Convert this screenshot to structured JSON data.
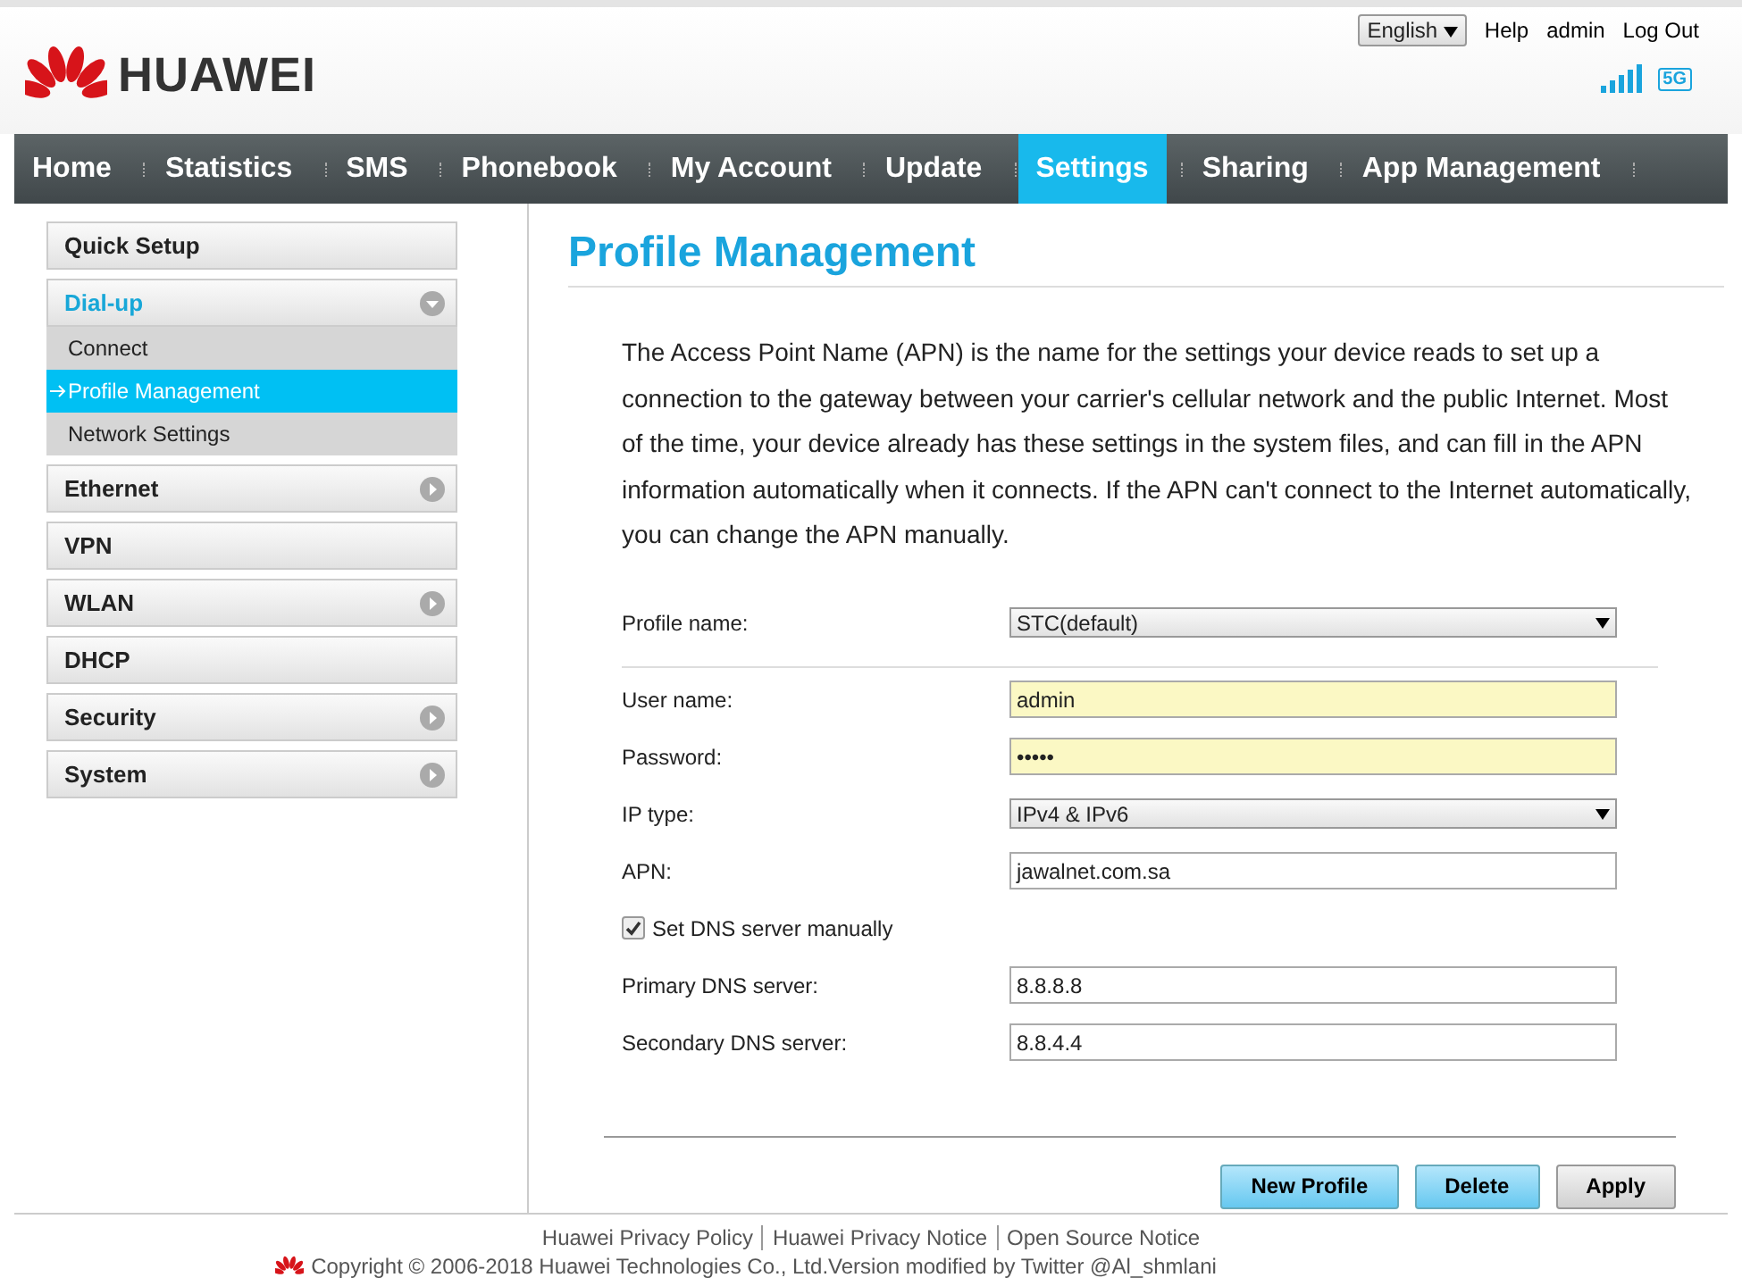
{
  "top_links": {
    "language": "English",
    "links": [
      "Help",
      "admin",
      "Log Out"
    ]
  },
  "brand": {
    "name": "HUAWEI"
  },
  "status": {
    "network_badge": "5G"
  },
  "nav": [
    {
      "label": "Home",
      "selected": false
    },
    {
      "label": "Statistics",
      "selected": false
    },
    {
      "label": "SMS",
      "selected": false
    },
    {
      "label": "Phonebook",
      "selected": false
    },
    {
      "label": "My Account",
      "selected": false
    },
    {
      "label": "Update",
      "selected": false
    },
    {
      "label": "Settings",
      "selected": true
    },
    {
      "label": "Sharing",
      "selected": false
    },
    {
      "label": "App Management",
      "selected": false
    }
  ],
  "sidebar": {
    "items": [
      {
        "label": "Quick Setup",
        "kind": "link"
      },
      {
        "label": "Dial-up",
        "kind": "group",
        "expanded": true,
        "children": [
          {
            "label": "Connect",
            "selected": false
          },
          {
            "label": "Profile Management",
            "selected": true
          },
          {
            "label": "Network Settings",
            "selected": false
          }
        ]
      },
      {
        "label": "Ethernet",
        "kind": "group",
        "expanded": false
      },
      {
        "label": "VPN",
        "kind": "link"
      },
      {
        "label": "WLAN",
        "kind": "group",
        "expanded": false
      },
      {
        "label": "DHCP",
        "kind": "link"
      },
      {
        "label": "Security",
        "kind": "group",
        "expanded": false
      },
      {
        "label": "System",
        "kind": "group",
        "expanded": false
      }
    ]
  },
  "page": {
    "title": "Profile Management",
    "description": "The Access Point Name (APN) is the name for the settings your device reads to set up a connection to the gateway between your carrier's cellular network and the public Internet. Most of the time, your device already has these settings in the system files, and can fill in the APN information automatically when it connects. If the APN can't connect to the Internet automatically, you can change the APN manually.",
    "fields": [
      {
        "kind": "select",
        "label": "Profile name:",
        "value": "STC(default)"
      },
      {
        "kind": "divider"
      },
      {
        "kind": "text",
        "label": "User name:",
        "value": "admin",
        "highlighted": true
      },
      {
        "kind": "password",
        "label": "Password:",
        "value": "•••••",
        "highlighted": true
      },
      {
        "kind": "select",
        "label": "IP type:",
        "value": "IPv4 & IPv6"
      },
      {
        "kind": "text",
        "label": "APN:",
        "value": "jawalnet.com.sa",
        "highlighted": false
      },
      {
        "kind": "checkbox",
        "label": "Set DNS server manually",
        "checked": true
      },
      {
        "kind": "text",
        "label": "Primary DNS server:",
        "value": "8.8.8.8",
        "highlighted": false
      },
      {
        "kind": "text",
        "label": "Secondary DNS server:",
        "value": "8.8.4.4",
        "highlighted": false
      }
    ],
    "buttons": [
      {
        "label": "New Profile",
        "kind": "primary"
      },
      {
        "label": "Delete",
        "kind": "primary"
      },
      {
        "label": "Apply",
        "kind": "default"
      }
    ]
  },
  "footer": {
    "links": [
      "Huawei Privacy Policy",
      "Huawei Privacy Notice",
      "Open Source Notice"
    ],
    "copyright": "Copyright © 2006-2018 Huawei Technologies Co., Ltd.Version modified by Twitter @Al_shmlani"
  }
}
